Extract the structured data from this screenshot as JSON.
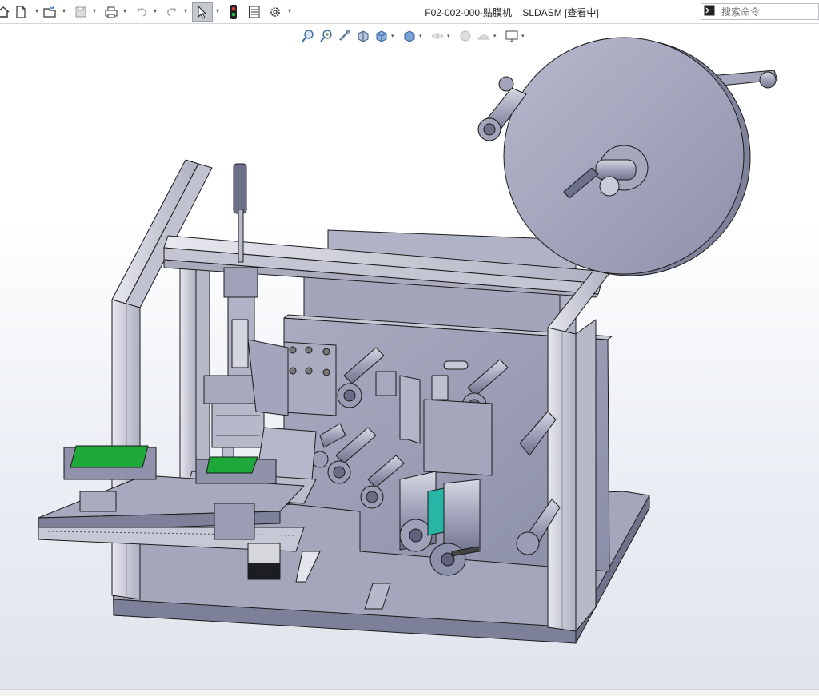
{
  "toolbar": {
    "items": [
      {
        "name": "home-icon"
      },
      {
        "name": "new-document-icon"
      },
      {
        "name": "open-folder-icon"
      },
      {
        "name": "save-icon"
      },
      {
        "name": "print-icon"
      },
      {
        "name": "undo-icon"
      },
      {
        "name": "redo-icon"
      },
      {
        "name": "select-cursor-icon",
        "pressed": true
      },
      {
        "name": "rebuild-traffic-light-icon"
      },
      {
        "name": "file-properties-icon"
      },
      {
        "name": "options-gear-icon"
      }
    ]
  },
  "document": {
    "title": "F02-002-000-贴膜机   .SLDASM [查看中]"
  },
  "search": {
    "placeholder": "搜索命令"
  },
  "heads_up_toolbar": [
    "zoom-to-fit-icon",
    "zoom-to-area-icon",
    "previous-view-icon",
    "section-view-icon",
    "view-orientation-icon",
    "display-style-icon",
    "hide-show-items-icon",
    "edit-appearance-icon",
    "apply-scene-icon",
    "view-settings-icon"
  ],
  "colors": {
    "machine_body": "#9ea1b8",
    "machine_dark": "#7a7d96",
    "machine_light": "#c4c6d6",
    "frame_profile": "#d4d6e0",
    "pcb_green": "#1fa83a",
    "teal_film": "#27b5a6",
    "outline": "#1a1a1a"
  }
}
